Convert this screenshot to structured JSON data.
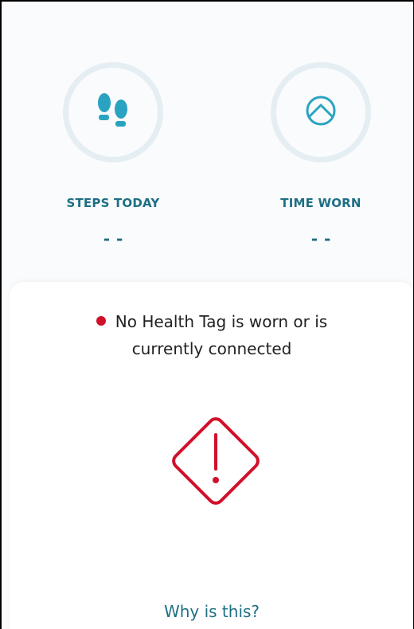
{
  "stats": {
    "steps": {
      "label": "STEPS TODAY",
      "value": "--",
      "icon": "footprints-icon"
    },
    "time_worn": {
      "label": "TIME WORN",
      "value": "--",
      "icon": "wear-time-icon"
    }
  },
  "status": {
    "message_line1": "No Health Tag is worn or is",
    "message_line2": "currently connected",
    "dot_color": "#d0102b",
    "icon": "warning-icon"
  },
  "help": {
    "link_label": "Why is this?"
  },
  "colors": {
    "accent": "#1e6f84",
    "icon_teal": "#2aa3c2",
    "ring": "#e4eef3",
    "alert": "#d0102b"
  }
}
